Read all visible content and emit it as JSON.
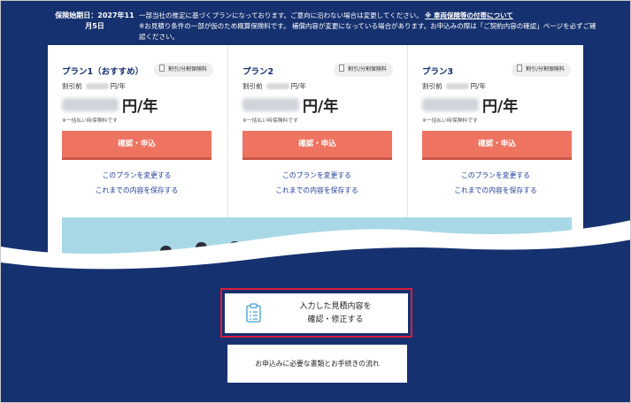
{
  "header": {
    "start_label": "保険始期日：2027年11月5日",
    "note_line1": "一部当社の推定に基づくプランになっております。ご意向に沿わない場合は変更してください。",
    "note_link": "※ 車両保険等の付帯について",
    "note_line2": "※お見積り条件の一部が仮のため概算保険料です。 補償内容が変更になっている場合があります。お申込みの際は「ご契約内容の確認」ページを必ずご確認ください。"
  },
  "plans": [
    {
      "name": "プラン1（おすすめ）",
      "badge": "割引/分割保険料",
      "before_label": "割引前",
      "before_unit": "円/年",
      "price_unit": "円/年",
      "tax_note": "※一括払い時保険料です",
      "apply_label": "確認・申込",
      "change_link": "このプランを変更する",
      "save_link": "これまでの内容を保存する"
    },
    {
      "name": "プラン2",
      "badge": "割引/分割保険料",
      "before_label": "割引前",
      "before_unit": "円/年",
      "price_unit": "円/年",
      "tax_note": "※一括払い時保険料です",
      "apply_label": "確認・申込",
      "change_link": "このプランを変更する",
      "save_link": "これまでの内容を保存する"
    },
    {
      "name": "プラン3",
      "badge": "割引/分割保険料",
      "before_label": "割引前",
      "before_unit": "円/年",
      "price_unit": "円/年",
      "tax_note": "※一括払い時保険料です",
      "apply_label": "確認・申込",
      "change_link": "このプランを変更する",
      "save_link": "これまでの内容を保存する"
    }
  ],
  "confirm": {
    "line1": "入力した見積内容を",
    "line2": "確認・修正する"
  },
  "flow": {
    "label": "お申込みに必要な書類とお手続きの流れ"
  },
  "colors": {
    "navy": "#16316f",
    "apply_button": "#ee7461",
    "link": "#1f3c97",
    "highlight": "#d81e3c"
  }
}
